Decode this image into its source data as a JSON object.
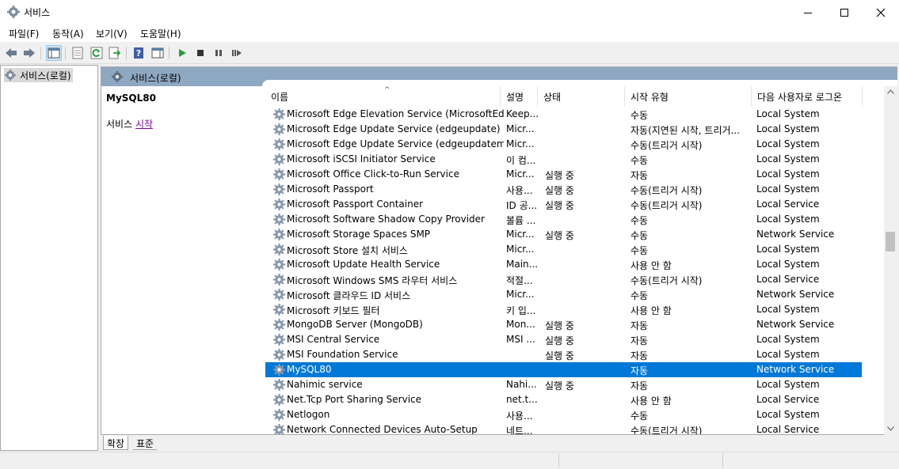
{
  "window": {
    "title": "서비스"
  },
  "menu": [
    "파일(F)",
    "동작(A)",
    "보기(V)",
    "도움말(H)"
  ],
  "tree": {
    "root_label": "서비스(로컬)"
  },
  "panel": {
    "header_title": "서비스(로컬)"
  },
  "detail": {
    "service_name": "MySQL80",
    "action_prefix": "서비스 ",
    "action_link": "시작"
  },
  "columns": [
    "이름",
    "설명",
    "상태",
    "시작 유형",
    "다음 사용자로 로그온"
  ],
  "rows": [
    {
      "name": "Microsoft Edge Elevation Service (MicrosoftEdge...",
      "desc": "Keep...",
      "status": "",
      "start": "수동",
      "logon": "Local System"
    },
    {
      "name": "Microsoft Edge Update Service (edgeupdate)",
      "desc": "Micr...",
      "status": "",
      "start": "자동(지연된 시작, 트리거...",
      "logon": "Local System"
    },
    {
      "name": "Microsoft Edge Update Service (edgeupdatem)",
      "desc": "Micr...",
      "status": "",
      "start": "수동(트리거 시작)",
      "logon": "Local System"
    },
    {
      "name": "Microsoft iSCSI Initiator Service",
      "desc": "이 컴...",
      "status": "",
      "start": "수동",
      "logon": "Local System"
    },
    {
      "name": "Microsoft Office Click-to-Run Service",
      "desc": "Micr...",
      "status": "실행 중",
      "start": "자동",
      "logon": "Local System"
    },
    {
      "name": "Microsoft Passport",
      "desc": "사용...",
      "status": "실행 중",
      "start": "수동(트리거 시작)",
      "logon": "Local System"
    },
    {
      "name": "Microsoft Passport Container",
      "desc": "ID 공...",
      "status": "실행 중",
      "start": "수동(트리거 시작)",
      "logon": "Local Service"
    },
    {
      "name": "Microsoft Software Shadow Copy Provider",
      "desc": "볼륨 ...",
      "status": "",
      "start": "수동",
      "logon": "Local System"
    },
    {
      "name": "Microsoft Storage Spaces SMP",
      "desc": "Micr...",
      "status": "실행 중",
      "start": "수동",
      "logon": "Network Service"
    },
    {
      "name": "Microsoft Store 설치 서비스",
      "desc": "Micr...",
      "status": "",
      "start": "수동",
      "logon": "Local System"
    },
    {
      "name": "Microsoft Update Health Service",
      "desc": "Main...",
      "status": "",
      "start": "사용 안 함",
      "logon": "Local System"
    },
    {
      "name": "Microsoft Windows SMS 라우터 서비스",
      "desc": "적절...",
      "status": "",
      "start": "수동(트리거 시작)",
      "logon": "Local Service"
    },
    {
      "name": "Microsoft 클라우드 ID 서비스",
      "desc": "Micr...",
      "status": "",
      "start": "수동",
      "logon": "Network Service"
    },
    {
      "name": "Microsoft 키보드 필터",
      "desc": "키 입...",
      "status": "",
      "start": "사용 안 함",
      "logon": "Local System"
    },
    {
      "name": "MongoDB Server (MongoDB)",
      "desc": "Mon...",
      "status": "실행 중",
      "start": "자동",
      "logon": "Network Service"
    },
    {
      "name": "MSI Central Service",
      "desc": "MSI ...",
      "status": "실행 중",
      "start": "자동",
      "logon": "Local System"
    },
    {
      "name": "MSI Foundation Service",
      "desc": "",
      "status": "실행 중",
      "start": "자동",
      "logon": "Local System"
    },
    {
      "name": "MySQL80",
      "desc": "",
      "status": "",
      "start": "자동",
      "logon": "Network Service",
      "selected": true
    },
    {
      "name": "Nahimic service",
      "desc": "Nahi...",
      "status": "실행 중",
      "start": "자동",
      "logon": "Local System"
    },
    {
      "name": "Net.Tcp Port Sharing Service",
      "desc": "net.t...",
      "status": "",
      "start": "사용 안 함",
      "logon": "Local Service"
    },
    {
      "name": "Netlogon",
      "desc": "사용...",
      "status": "",
      "start": "수동",
      "logon": "Local System"
    },
    {
      "name": "Network Connected Devices Auto-Setup",
      "desc": "네트...",
      "status": "",
      "start": "수동(트리거 시작)",
      "logon": "Local Service"
    }
  ],
  "bottom_tabs": [
    "확장",
    "표준"
  ],
  "colors": {
    "selection": "#0078d7",
    "panel_header": "#8fa8c2",
    "link": "#7a0aa6"
  }
}
